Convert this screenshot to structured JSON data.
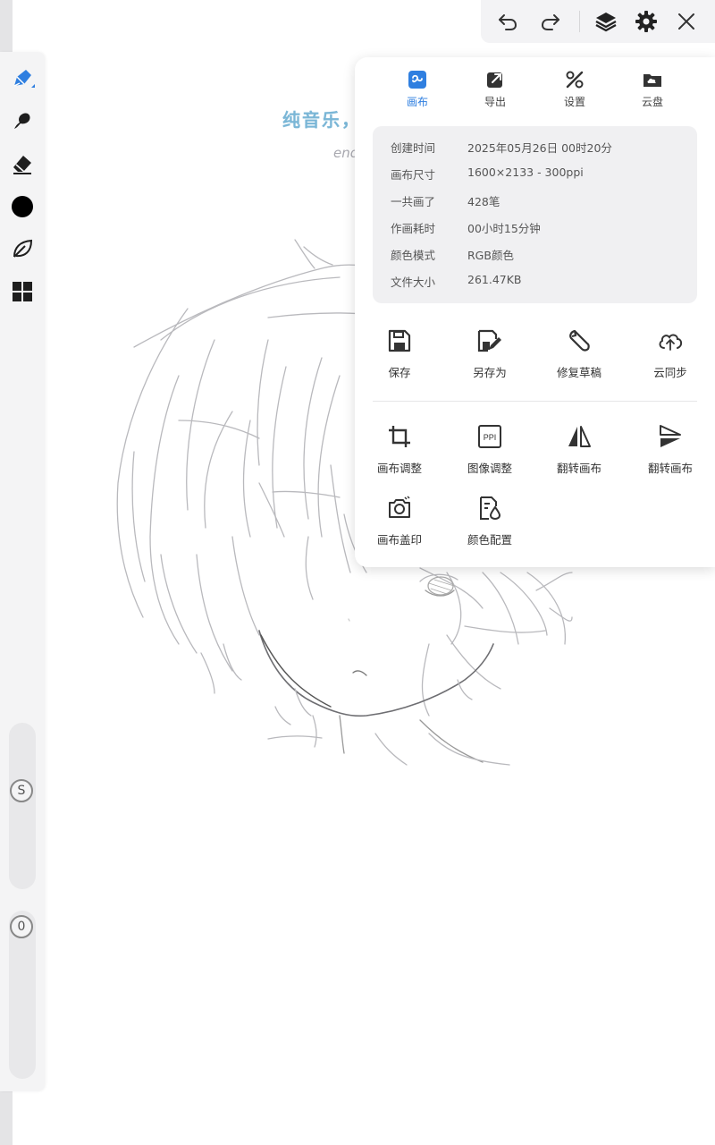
{
  "overlay": {
    "title": "纯音乐，请欣赏",
    "subtitle": "end..."
  },
  "toolbar_left": {
    "tools": [
      {
        "icon": "pen-icon",
        "active": true
      },
      {
        "icon": "smudge-icon"
      },
      {
        "icon": "eraser-icon"
      },
      {
        "icon": "color-black-icon",
        "color": "#000000"
      },
      {
        "icon": "leaf-icon"
      },
      {
        "icon": "grid-icon"
      }
    ],
    "size_badge": "S",
    "opacity_badge": "0"
  },
  "top_bar": {
    "buttons": [
      "undo-icon",
      "redo-icon",
      "layers-icon",
      "gear-icon",
      "close-icon"
    ]
  },
  "panel": {
    "tabs": [
      {
        "label": "画布",
        "icon": "canvas-icon",
        "active": true
      },
      {
        "label": "导出",
        "icon": "export-icon"
      },
      {
        "label": "设置",
        "icon": "settings-tools-icon"
      },
      {
        "label": "云盘",
        "icon": "cloud-folder-icon"
      }
    ],
    "info": [
      {
        "key": "创建时间",
        "value": "2025年05月26日 00时20分"
      },
      {
        "key": "画布尺寸",
        "value": "1600×2133 - 300ppi"
      },
      {
        "key": "一共画了",
        "value": "428笔"
      },
      {
        "key": "作画耗时",
        "value": "00小时15分钟"
      },
      {
        "key": "颜色模式",
        "value": "RGB颜色"
      },
      {
        "key": "文件大小",
        "value": "261.47KB"
      }
    ],
    "actions_primary": [
      {
        "label": "保存",
        "icon": "save-icon"
      },
      {
        "label": "另存为",
        "icon": "save-as-icon"
      },
      {
        "label": "修复草稿",
        "icon": "wrench-icon"
      },
      {
        "label": "云同步",
        "icon": "cloud-sync-icon"
      }
    ],
    "actions_secondary": [
      {
        "label": "画布调整",
        "icon": "crop-icon"
      },
      {
        "label": "图像调整",
        "icon": "ppi-icon",
        "icon_text": "PPI"
      },
      {
        "label": "翻转画布",
        "icon": "flip-horizontal-icon"
      },
      {
        "label": "翻转画布",
        "icon": "flip-vertical-icon"
      },
      {
        "label": "画布盖印",
        "icon": "camera-icon"
      },
      {
        "label": "颜色配置",
        "icon": "color-profile-icon"
      }
    ]
  },
  "colors": {
    "accent": "#2f7fe0",
    "panel_bg": "#ffffff",
    "info_bg": "#f0f0f2",
    "toolbar_bg": "#f4f4f5",
    "overlay_title": "#7ab6d6"
  }
}
